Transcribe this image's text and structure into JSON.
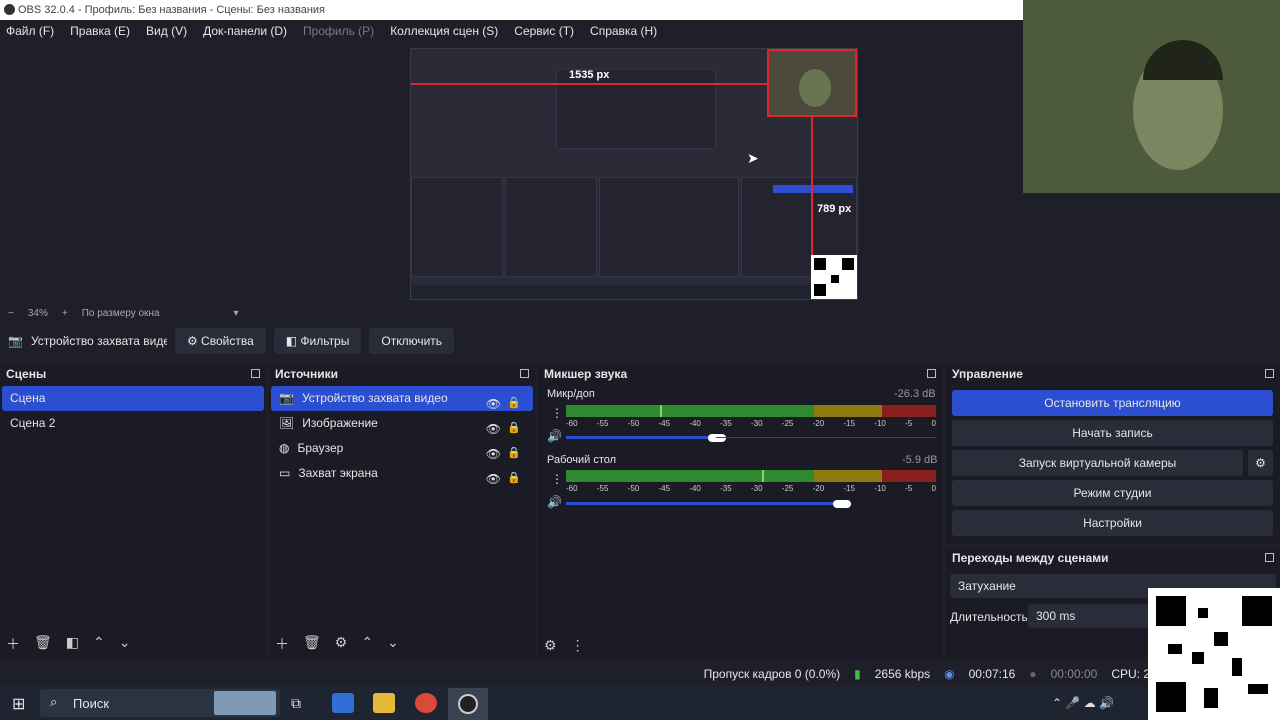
{
  "window": {
    "title": "OBS 32.0.4 - Профиль: Без названия - Сцены: Без названия"
  },
  "menu": [
    "Файл (F)",
    "Правка (E)",
    "Вид (V)",
    "Док-панели (D)",
    "Профиль (P)",
    "Коллекция сцен (S)",
    "Сервис (T)",
    "Справка (H)"
  ],
  "preview": {
    "label_h": "1535 px",
    "label_v": "789 px"
  },
  "zoom": {
    "minus": "−",
    "value": "34%",
    "plus": "+",
    "mode": "По размеру окна"
  },
  "source_toolbar": {
    "source_name": "Устройство захвата видео",
    "properties": "Свойства",
    "filters": "Фильтры",
    "disconnect": "Отключить"
  },
  "scenes": {
    "title": "Сцены",
    "items": [
      "Сцена",
      "Сцена 2"
    ]
  },
  "sources": {
    "title": "Источники",
    "items": [
      "Устройство захвата видео",
      "Изображение",
      "Браузер",
      "Захват экрана"
    ]
  },
  "mixer": {
    "title": "Микшер звука",
    "channels": [
      {
        "name": "Микр/доп",
        "db": "-26.3 dB"
      },
      {
        "name": "Рабочий стол",
        "db": "-5.9 dB"
      }
    ],
    "ticks": [
      "-60",
      "-55",
      "-50",
      "-45",
      "-40",
      "-35",
      "-30",
      "-25",
      "-20",
      "-15",
      "-10",
      "-5",
      "0"
    ]
  },
  "controls": {
    "title": "Управление",
    "stop_stream": "Остановить трансляцию",
    "start_record": "Начать запись",
    "virtual_cam": "Запуск виртуальной камеры",
    "studio_mode": "Режим студии",
    "settings": "Настройки"
  },
  "transitions": {
    "title": "Переходы между сценами",
    "type": "Затухание",
    "duration_label": "Длительность",
    "duration_value": "300 ms"
  },
  "status": {
    "dropped": "Пропуск кадров 0 (0.0%)",
    "bitrate": "2656 kbps",
    "stream_time": "00:07:16",
    "record_time": "00:00:00",
    "cpu": "CPU: 2"
  },
  "taskbar": {
    "search": "Поиск"
  },
  "colors": {
    "accent": "#2b4fd0",
    "bg": "#1e1f29",
    "record_red": "#e0282a"
  }
}
